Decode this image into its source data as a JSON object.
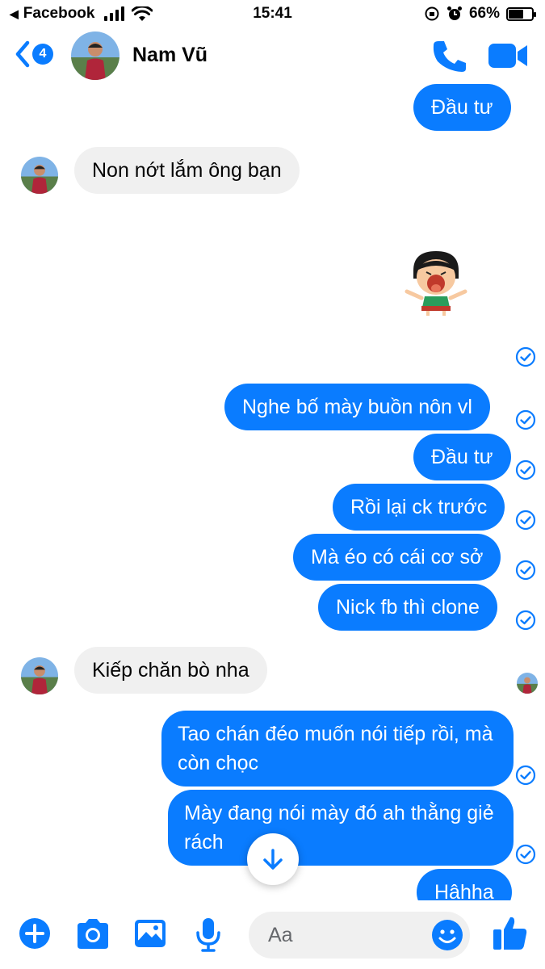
{
  "status_bar": {
    "back_app": "Facebook",
    "time": "15:41",
    "battery": "66%",
    "battery_level": 0.66
  },
  "header": {
    "unread_count": "4",
    "contact_name": "Nam Vũ"
  },
  "messages": [
    {
      "side": "out",
      "text": "Đầu tư"
    },
    {
      "side": "in",
      "text": "Non nớt lắm ông bạn"
    },
    {
      "side": "out",
      "type": "sticker",
      "sticker": "laughing-girl-sticker"
    },
    {
      "side": "out",
      "text": "Nghe bố mày buồn nôn vl"
    },
    {
      "side": "out",
      "text": "Đầu tư"
    },
    {
      "side": "out",
      "text": "Rồi lại ck trước"
    },
    {
      "side": "out",
      "text": "Mà éo có cái cơ sở"
    },
    {
      "side": "out",
      "text": "Nick fb thì clone"
    },
    {
      "side": "in",
      "text": "Kiếp chăn bò nha"
    },
    {
      "side": "out",
      "text": "Tao chán đéo muốn nói tiếp rồi, mà còn chọc"
    },
    {
      "side": "out",
      "text": "Mày đang nói mày đó ah thằng giẻ rách"
    },
    {
      "side": "out",
      "text": "Hâhha"
    }
  ],
  "composer": {
    "placeholder": "Aa"
  },
  "colors": {
    "accent": "#0a7cff",
    "incoming_bubble": "#f0f0f0"
  },
  "icons": [
    "back-chevron-icon",
    "phone-icon",
    "video-camera-icon",
    "check-circle-icon",
    "arrow-down-icon",
    "plus-icon",
    "camera-icon",
    "image-icon",
    "microphone-icon",
    "emoji-icon",
    "thumbs-up-icon"
  ]
}
